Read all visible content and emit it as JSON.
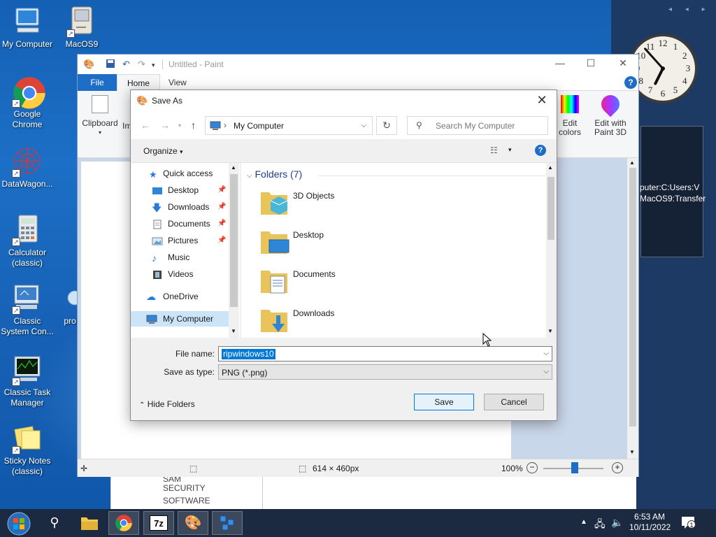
{
  "desktop": {
    "icons": [
      {
        "label": "My Computer"
      },
      {
        "label": "MacOS9"
      },
      {
        "label": "Google Chrome"
      },
      {
        "label": "DataWagon..."
      },
      {
        "label": "Calculator (classic)"
      },
      {
        "label": "Classic System Con..."
      },
      {
        "label": "pro"
      },
      {
        "label": "Classic Task Manager"
      },
      {
        "label": "Sticky Notes (classic)"
      }
    ],
    "gadget_lines": [
      "puter:C:Users:V",
      "MacOS9:Transfer"
    ],
    "clock": {
      "hour": 6,
      "minute": 53
    }
  },
  "paint": {
    "title": "Untitled - Paint",
    "tabs": {
      "file": "File",
      "home": "Home",
      "view": "View"
    },
    "ribbon": {
      "clipboard": "Clipboard",
      "image_partial": "Im",
      "edit_colors": "Edit colors",
      "edit_3d": "Edit with Paint 3D"
    },
    "status": {
      "size": "614 × 460px",
      "zoom": "100%"
    },
    "help": "?"
  },
  "registry": {
    "items": [
      "SAM",
      "SECURITY",
      "SOFTWARE"
    ]
  },
  "dialog": {
    "title": "Save As",
    "address": "My Computer",
    "search_placeholder": "Search My Computer",
    "organize": "Organize",
    "nav": [
      {
        "label": "Quick access",
        "icon": "star-icon",
        "pinned": false
      },
      {
        "label": "Desktop",
        "icon": "desktop-folder-icon",
        "pinned": true
      },
      {
        "label": "Downloads",
        "icon": "downloads-folder-icon",
        "pinned": true
      },
      {
        "label": "Documents",
        "icon": "documents-folder-icon",
        "pinned": true
      },
      {
        "label": "Pictures",
        "icon": "pictures-folder-icon",
        "pinned": true
      },
      {
        "label": "Music",
        "icon": "music-icon",
        "pinned": false
      },
      {
        "label": "Videos",
        "icon": "videos-icon",
        "pinned": false
      },
      {
        "label": "OneDrive",
        "icon": "cloud-icon",
        "pinned": false
      },
      {
        "label": "My Computer",
        "icon": "computer-icon",
        "pinned": false
      }
    ],
    "group_header": "Folders (7)",
    "folders": [
      {
        "label": "3D Objects"
      },
      {
        "label": "Desktop"
      },
      {
        "label": "Documents"
      },
      {
        "label": "Downloads"
      }
    ],
    "file_name_label": "File name:",
    "file_name": "ripwindows10",
    "save_type_label": "Save as type:",
    "save_type": "PNG (*.png)",
    "hide_folders": "Hide Folders",
    "save": "Save",
    "cancel": "Cancel"
  },
  "taskbar": {
    "time": "6:53 AM",
    "date": "10/11/2022",
    "notification_count": "1"
  }
}
